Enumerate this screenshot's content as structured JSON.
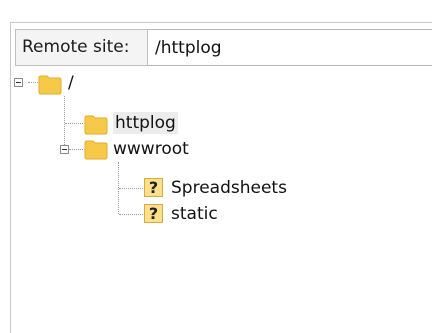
{
  "remote_site": {
    "label": "Remote site:",
    "path_value": "/httplog"
  },
  "tree": {
    "root": {
      "label": "/",
      "icon": "folder-icon",
      "expanded": true
    },
    "items": [
      {
        "label": "httplog",
        "icon": "folder-icon",
        "selected": true
      },
      {
        "label": "wwwroot",
        "icon": "folder-icon",
        "expanded": true
      },
      {
        "label": "Spreadsheets",
        "icon": "unknown-folder-icon"
      },
      {
        "label": "static",
        "icon": "unknown-folder-icon"
      }
    ]
  },
  "colors": {
    "folder": "#f7c948",
    "folder_dark": "#e0ad2c",
    "highlight": "#ececec"
  }
}
